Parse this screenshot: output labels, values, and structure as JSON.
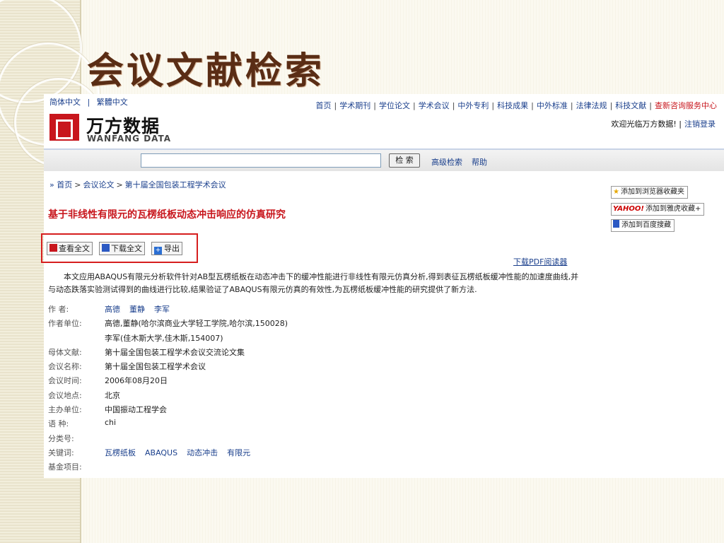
{
  "slide": {
    "title": "会议文献检索"
  },
  "site": {
    "lang_simplified": "简体中文",
    "lang_sep": "|",
    "lang_traditional": "繁體中文",
    "logo_cn": "万方数据",
    "logo_en": "WANFANG DATA",
    "nav": [
      "首页",
      "学术期刊",
      "学位论文",
      "学术会议",
      "中外专利",
      "科技成果",
      "中外标准",
      "法律法规",
      "科技文献",
      "查新咨询服务中心"
    ],
    "nav_sep": "|",
    "welcome": "欢迎光临万方数据!",
    "welcome_sep": "|",
    "logout_login": "注销登录"
  },
  "search": {
    "value": "",
    "button": "检 索",
    "advanced": "高级检索",
    "help": "帮助"
  },
  "breadcrumb": {
    "arrow": "»",
    "home": "首页",
    "gt": ">",
    "cat": "会议论文",
    "conf": "第十届全国包装工程学术会议"
  },
  "paper": {
    "title": "基于非线性有限元的瓦楞纸板动态冲击响应的仿真研究",
    "actions": {
      "view": "查看全文",
      "download": "下载全文",
      "export": "导出"
    },
    "pdf_reader": "下载PDF阅读器",
    "abstract": "本文应用ABAQUS有限元分析软件针对AB型瓦楞纸板在动态冲击下的缓冲性能进行非线性有限元仿真分析,得到表征瓦楞纸板缓冲性能的加速度曲线,并与动态跌落实验测试得到的曲线进行比较,结果验证了ABAQUS有限元仿真的有效性,为瓦楞纸板缓冲性能的研究提供了新方法.",
    "meta": {
      "authors_label": "作 者:",
      "authors": [
        "高德",
        "董静",
        "李军"
      ],
      "affil_label": "作者单位:",
      "affil_1": "高德,董静(哈尔滨商业大学轻工学院,哈尔滨,150028)",
      "affil_2": "李军(佳木斯大学,佳木斯,154007)",
      "source_label": "母体文献:",
      "source": "第十届全国包装工程学术会议交流论文集",
      "conf_label": "会议名称:",
      "conf": "第十届全国包装工程学术会议",
      "date_label": "会议时间:",
      "date": "2006年08月20日",
      "place_label": "会议地点:",
      "place": "北京",
      "org_label": "主办单位:",
      "org": "中国振动工程学会",
      "lang_label": "语 种:",
      "lang": "chi",
      "class_label": "分类号:",
      "class": "",
      "kw_label": "关键词:",
      "keywords": [
        "瓦楞纸板",
        "ABAQUS",
        "动态冲击",
        "有限元"
      ],
      "fund_label": "基金项目:",
      "fund": ""
    }
  },
  "side": {
    "browser_fav": "添加到浏览器收藏夹",
    "yahoo_logo": "YAHOO!",
    "yahoo_fav": "添加到雅虎收藏+",
    "baidu_fav": "添加到百度搜藏"
  }
}
